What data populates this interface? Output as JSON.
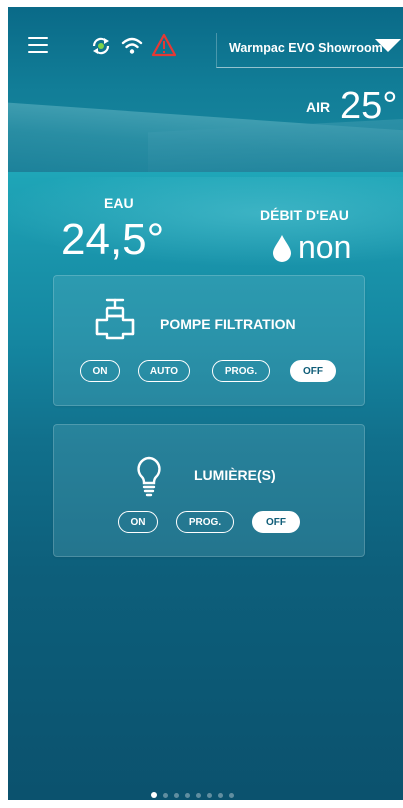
{
  "header": {
    "device_name": "Warmpac EVO Showroom",
    "icons": [
      "menu-icon",
      "sync-icon",
      "wifi-icon",
      "alert-icon",
      "chevron-down-icon"
    ]
  },
  "air": {
    "label": "AIR",
    "value": "25°"
  },
  "water": {
    "label": "EAU",
    "value": "24,5°"
  },
  "flow": {
    "label": "DÉBIT D'EAU",
    "value": "non"
  },
  "pump_card": {
    "title": "POMPE FILTRATION",
    "buttons": [
      "ON",
      "AUTO",
      "PROG.",
      "OFF"
    ],
    "selected": "OFF"
  },
  "light_card": {
    "title": "LUMIÈRE(S)",
    "buttons": [
      "ON",
      "PROG.",
      "OFF"
    ],
    "selected": "OFF"
  },
  "pagination": {
    "pages": 8,
    "current": 1
  },
  "colors": {
    "accent_text": "#0e5c77",
    "alert": "#e53935",
    "sync_dot": "#7cd34a"
  }
}
